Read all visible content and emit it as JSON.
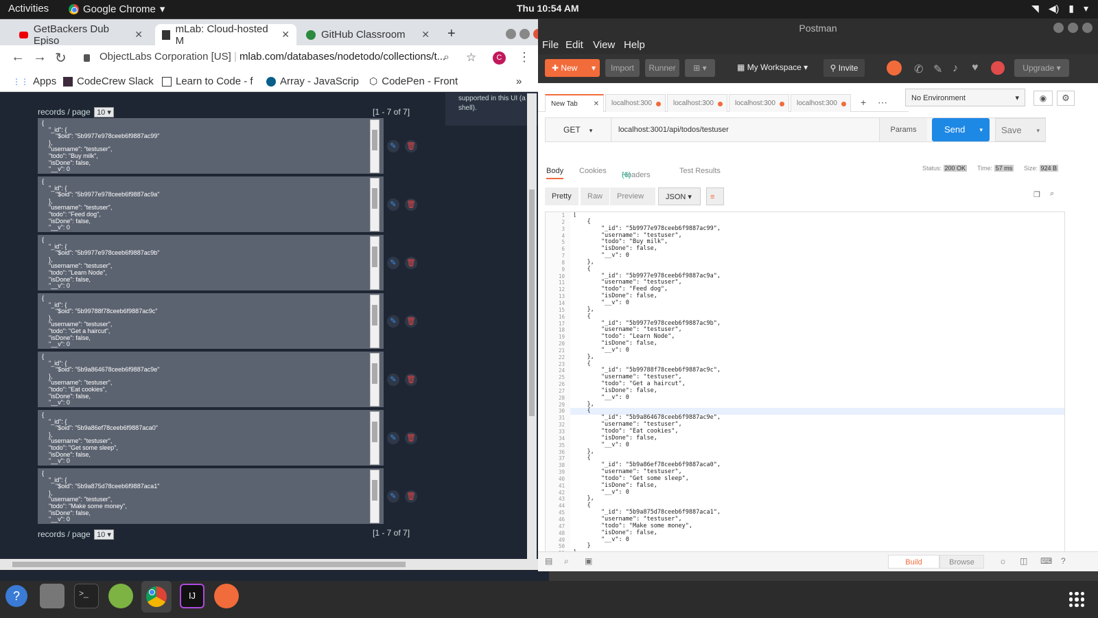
{
  "system": {
    "activities": "Activities",
    "app_name": "Google Chrome",
    "clock": "Thu 10:54 AM"
  },
  "chrome": {
    "tabs": [
      {
        "label": "GetBackers Dub Episo"
      },
      {
        "label": "mLab: Cloud-hosted M"
      },
      {
        "label": "GitHub Classroom"
      }
    ],
    "url_org": "ObjectLabs Corporation [US]",
    "url_path": "mlab.com/databases/nodetodo/collections/t...",
    "bookmarks": [
      {
        "label": "Apps"
      },
      {
        "label": "CodeCrew Slack"
      },
      {
        "label": "Learn to Code - f"
      },
      {
        "label": "Array - JavaScrip"
      },
      {
        "label": "CodePen - Front"
      }
    ],
    "side_note_line1": "supported in this UI (a",
    "side_note_line2": "shell)."
  },
  "mlab": {
    "rpp_label": "records / page",
    "rpp_value": "10",
    "count_text": "[1 - 7 of 7]",
    "records": [
      {
        "text": "{\n    \"_id\": {\n        \"$oid\": \"5b9977e978ceeb6f9887ac99\"\n    },\n    \"username\": \"testuser\",\n    \"todo\": \"Buy milk\",\n    \"isDone\": false,\n    \"__v\": 0"
      },
      {
        "text": "{\n    \"_id\": {\n        \"$oid\": \"5b9977e978ceeb6f9887ac9a\"\n    },\n    \"username\": \"testuser\",\n    \"todo\": \"Feed dog\",\n    \"isDone\": false,\n    \"__v\": 0"
      },
      {
        "text": "{\n    \"_id\": {\n        \"$oid\": \"5b9977e978ceeb6f9887ac9b\"\n    },\n    \"username\": \"testuser\",\n    \"todo\": \"Learn Node\",\n    \"isDone\": false,\n    \"__v\": 0"
      },
      {
        "text": "{\n    \"_id\": {\n        \"$oid\": \"5b99788f78ceeb6f9887ac9c\"\n    },\n    \"username\": \"testuser\",\n    \"todo\": \"Get a haircut\",\n    \"isDone\": false,\n    \"__v\": 0"
      },
      {
        "text": "{\n    \"_id\": {\n        \"$oid\": \"5b9a864678ceeb6f9887ac9e\"\n    },\n    \"username\": \"testuser\",\n    \"todo\": \"Eat cookies\",\n    \"isDone\": false,\n    \"__v\": 0"
      },
      {
        "text": "{\n    \"_id\": {\n        \"$oid\": \"5b9a86ef78ceeb6f9887aca0\"\n    },\n    \"username\": \"testuser\",\n    \"todo\": \"Get some sleep\",\n    \"isDone\": false,\n    \"__v\": 0"
      },
      {
        "text": "{\n    \"_id\": {\n        \"$oid\": \"5b9a875d78ceeb6f9887aca1\"\n    },\n    \"username\": \"testuser\",\n    \"todo\": \"Make some money\",\n    \"isDone\": false,\n    \"__v\": 0"
      }
    ]
  },
  "postman": {
    "window_title": "Postman",
    "menu": [
      "File",
      "Edit",
      "View",
      "Help"
    ],
    "toolbar": {
      "new": "New",
      "import": "Import",
      "runner": "Runner",
      "workspace": "My Workspace",
      "invite": "Invite",
      "upgrade": "Upgrade"
    },
    "tabs": [
      "New Tab",
      "localhost:300",
      "localhost:300",
      "localhost:300",
      "localhost:300"
    ],
    "environment": "No Environment",
    "method": "GET",
    "request_url": "localhost:3001/api/todos/testuser",
    "params": "Params",
    "send": "Send",
    "save": "Save",
    "response_tabs": {
      "body": "Body",
      "cookies": "Cookies",
      "headers": "Headers",
      "headers_count": "(6)",
      "tests": "Test Results"
    },
    "status_label": "Status:",
    "status_value": "200 OK",
    "time_label": "Time:",
    "time_value": "57 ms",
    "size_label": "Size:",
    "size_value": "924 B",
    "view_modes": [
      "Pretty",
      "Raw",
      "Preview"
    ],
    "format": "JSON",
    "line_numbers": "1\n2\n3\n4\n5\n6\n7\n8\n9\n10\n11\n12\n13\n14\n15\n16\n17\n18\n19\n20\n21\n22\n23\n24\n25\n26\n27\n28\n29\n30\n31\n32\n33\n34\n35\n36\n37\n38\n39\n40\n41\n42\n43\n44\n45\n46\n47\n48\n49\n50\n51",
    "response_body": "[\n    {\n        \"_id\": \"5b9977e978ceeb6f9887ac99\",\n        \"username\": \"testuser\",\n        \"todo\": \"Buy milk\",\n        \"isDone\": false,\n        \"__v\": 0\n    },\n    {\n        \"_id\": \"5b9977e978ceeb6f9887ac9a\",\n        \"username\": \"testuser\",\n        \"todo\": \"Feed dog\",\n        \"isDone\": false,\n        \"__v\": 0\n    },\n    {\n        \"_id\": \"5b9977e978ceeb6f9887ac9b\",\n        \"username\": \"testuser\",\n        \"todo\": \"Learn Node\",\n        \"isDone\": false,\n        \"__v\": 0\n    },\n    {\n        \"_id\": \"5b99788f78ceeb6f9887ac9c\",\n        \"username\": \"testuser\",\n        \"todo\": \"Get a haircut\",\n        \"isDone\": false,\n        \"__v\": 0\n    },\n    {\n        \"_id\": \"5b9a864678ceeb6f9887ac9e\",\n        \"username\": \"testuser\",\n        \"todo\": \"Eat cookies\",\n        \"isDone\": false,\n        \"__v\": 0\n    },\n    {\n        \"_id\": \"5b9a86ef78ceeb6f9887aca0\",\n        \"username\": \"testuser\",\n        \"todo\": \"Get some sleep\",\n        \"isDone\": false,\n        \"__v\": 0\n    },\n    {\n        \"_id\": \"5b9a875d78ceeb6f9887aca1\",\n        \"username\": \"testuser\",\n        \"todo\": \"Make some money\",\n        \"isDone\": false,\n        \"__v\": 0\n    }\n]",
    "footer": {
      "build": "Build",
      "browse": "Browse"
    }
  },
  "colors": {
    "postman_accent": "#f26b3a",
    "send_blue": "#1e88e5",
    "mlab_bg": "#1f2633",
    "record_bg": "#5c6370"
  }
}
